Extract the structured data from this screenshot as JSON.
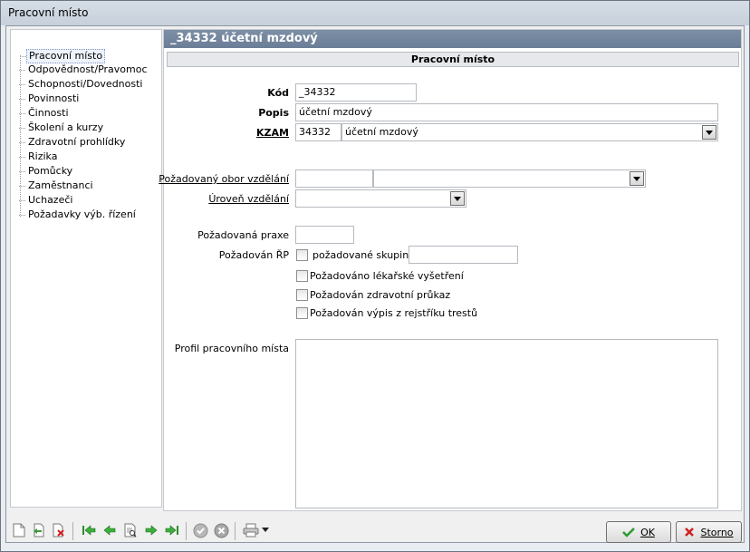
{
  "window": {
    "title": "Pracovní místo"
  },
  "sidebar": {
    "items": [
      {
        "label": "Pracovní místo",
        "selected": true
      },
      {
        "label": "Odpovědnost/Pravomoc"
      },
      {
        "label": "Schopnosti/Dovednosti"
      },
      {
        "label": "Povinnosti"
      },
      {
        "label": "Činnosti"
      },
      {
        "label": "Školení a kurzy"
      },
      {
        "label": "Zdravotní prohlídky"
      },
      {
        "label": "Rizika"
      },
      {
        "label": "Pomůcky"
      },
      {
        "label": "Zaměstnanci"
      },
      {
        "label": "Uchazeči"
      },
      {
        "label": "Požadavky výb. řízení"
      }
    ]
  },
  "header": {
    "title": "_34332  účetní mzdový"
  },
  "section": {
    "title": "Pracovní místo"
  },
  "form": {
    "kod": {
      "label": "Kód",
      "value": "_34332"
    },
    "popis": {
      "label": "Popis",
      "value": "účetní mzdový"
    },
    "kzam": {
      "label": "KZAM",
      "code": "34332",
      "value": "účetní mzdový"
    },
    "obor": {
      "label": "Požadovaný obor vzdělání",
      "code": "",
      "value": ""
    },
    "uroven": {
      "label": "Úroveň vzdělání",
      "value": ""
    },
    "praxe": {
      "label": "Požadovaná praxe",
      "value": ""
    },
    "rp": {
      "label": "Požadován ŘP",
      "checkbox_label": "požadované skupiny",
      "checked": false,
      "value": ""
    },
    "lekarske": {
      "label": "Požadováno lékařské vyšetření",
      "checked": false
    },
    "prukaz": {
      "label": "Požadován zdravotní průkaz",
      "checked": false
    },
    "rejstrik": {
      "label": "Požadován výpis z rejstříku trestů",
      "checked": false
    },
    "profil": {
      "label": "Profil pracovního místa",
      "value": ""
    }
  },
  "toolbar": {
    "icons": [
      "new-record-icon",
      "copy-record-icon",
      "delete-record-icon",
      "first-record-icon",
      "previous-record-icon",
      "search-record-icon",
      "next-record-icon",
      "last-record-icon",
      "confirm-icon",
      "cancel-icon",
      "print-icon",
      "print-dropdown-icon"
    ]
  },
  "buttons": {
    "ok": {
      "label": "OK",
      "color": "#2e9a2e"
    },
    "storno": {
      "label": "Storno",
      "color": "#d02020"
    }
  }
}
